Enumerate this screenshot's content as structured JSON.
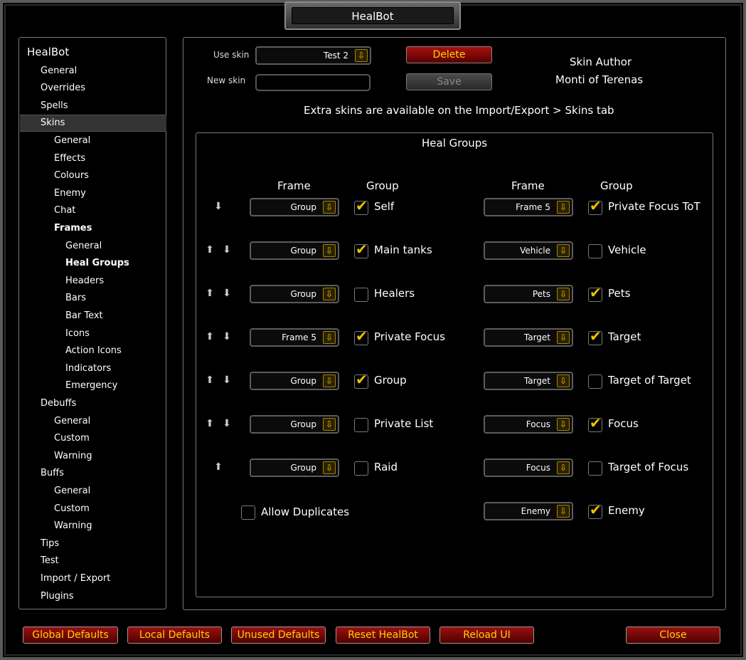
{
  "window": {
    "title": "HealBot"
  },
  "nav": {
    "items": [
      {
        "label": "HealBot",
        "level": 0
      },
      {
        "label": "General",
        "level": 1
      },
      {
        "label": "Overrides",
        "level": 1
      },
      {
        "label": "Spells",
        "level": 1
      },
      {
        "label": "Skins",
        "level": 1,
        "selected": true
      },
      {
        "label": "General",
        "level": 2
      },
      {
        "label": "Effects",
        "level": 2
      },
      {
        "label": "Colours",
        "level": 2
      },
      {
        "label": "Enemy",
        "level": 2
      },
      {
        "label": "Chat",
        "level": 2
      },
      {
        "label": "Frames",
        "level": 2,
        "bold": true
      },
      {
        "label": "General",
        "level": 3
      },
      {
        "label": "Heal Groups",
        "level": 3,
        "bold": true
      },
      {
        "label": "Headers",
        "level": 3
      },
      {
        "label": "Bars",
        "level": 3
      },
      {
        "label": "Bar Text",
        "level": 3
      },
      {
        "label": "Icons",
        "level": 3
      },
      {
        "label": "Action Icons",
        "level": 3
      },
      {
        "label": "Indicators",
        "level": 3
      },
      {
        "label": "Emergency",
        "level": 3
      },
      {
        "label": "Debuffs",
        "level": 1
      },
      {
        "label": "General",
        "level": 2
      },
      {
        "label": "Custom",
        "level": 2
      },
      {
        "label": "Warning",
        "level": 2
      },
      {
        "label": "Buffs",
        "level": 1
      },
      {
        "label": "General",
        "level": 2
      },
      {
        "label": "Custom",
        "level": 2
      },
      {
        "label": "Warning",
        "level": 2
      },
      {
        "label": "Tips",
        "level": 1
      },
      {
        "label": "Test",
        "level": 1
      },
      {
        "label": "Import / Export",
        "level": 1
      },
      {
        "label": "Plugins",
        "level": 1
      }
    ]
  },
  "skin": {
    "use_skin_label": "Use skin",
    "use_skin_value": "Test 2",
    "new_skin_label": "New skin",
    "new_skin_value": "",
    "delete_label": "Delete",
    "save_label": "Save",
    "author_title": "Skin Author",
    "author_name": "Monti of Terenas",
    "extra_note": "Extra skins are available on the Import/Export > Skins tab"
  },
  "heal_groups": {
    "title": "Heal Groups",
    "col_frame": "Frame",
    "col_group": "Group",
    "left": [
      {
        "arrows": "down",
        "frame": "Group",
        "checked": true,
        "label": "Self"
      },
      {
        "arrows": "updown",
        "frame": "Group",
        "checked": true,
        "label": "Main tanks"
      },
      {
        "arrows": "updown",
        "frame": "Group",
        "checked": false,
        "label": "Healers"
      },
      {
        "arrows": "updown",
        "frame": "Frame 5",
        "checked": true,
        "label": "Private Focus"
      },
      {
        "arrows": "updown",
        "frame": "Group",
        "checked": true,
        "label": "Group"
      },
      {
        "arrows": "updown",
        "frame": "Group",
        "checked": false,
        "label": "Private List"
      },
      {
        "arrows": "up",
        "frame": "Group",
        "checked": false,
        "label": "Raid"
      }
    ],
    "right": [
      {
        "frame": "Frame 5",
        "checked": true,
        "label": "Private Focus ToT"
      },
      {
        "frame": "Vehicle",
        "checked": false,
        "label": "Vehicle"
      },
      {
        "frame": "Pets",
        "checked": true,
        "label": "Pets"
      },
      {
        "frame": "Target",
        "checked": true,
        "label": "Target"
      },
      {
        "frame": "Target",
        "checked": false,
        "label": "Target of Target"
      },
      {
        "frame": "Focus",
        "checked": true,
        "label": "Focus"
      },
      {
        "frame": "Focus",
        "checked": false,
        "label": "Target of Focus"
      },
      {
        "frame": "Enemy",
        "checked": true,
        "label": "Enemy"
      }
    ],
    "allow_duplicates": {
      "label": "Allow Duplicates",
      "checked": false
    }
  },
  "bottom_buttons": [
    "Global Defaults",
    "Local Defaults",
    "Unused Defaults",
    "Reset HealBot",
    "Reload UI",
    "Close"
  ],
  "colors": {
    "accent_gold": "#ffd200",
    "button_red": "#8a0c0c"
  }
}
